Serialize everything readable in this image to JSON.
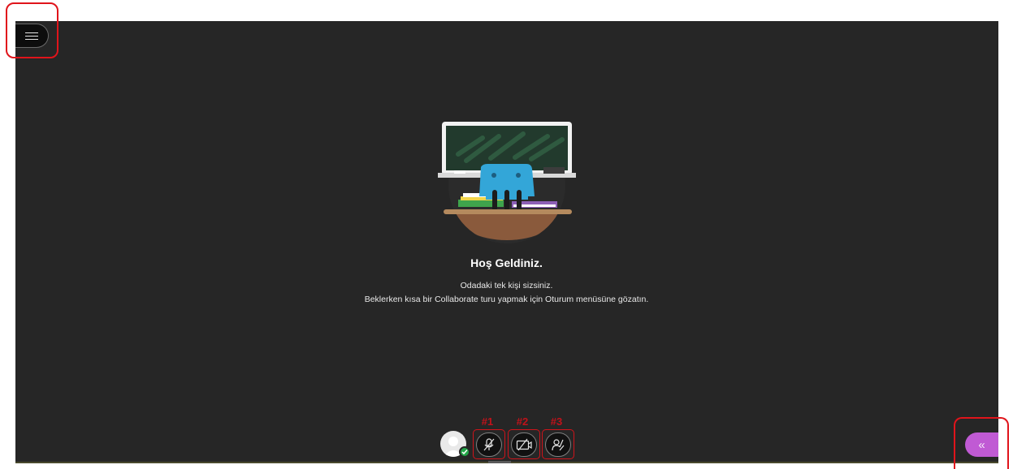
{
  "welcome": {
    "title": "Hoş Geldiniz.",
    "line1": "Odadaki tek kişi sizsiniz.",
    "line2": "Beklerken kısa bir Collaborate turu yapmak için Oturum menüsüne gözatın."
  },
  "controls": {
    "mic_label": "#1",
    "camera_label": "#2",
    "hand_label": "#3"
  },
  "collab_panel": {
    "toggle_glyph": "«"
  },
  "icons": {
    "menu": "hamburger-menu-icon",
    "mic": "microphone-muted-icon",
    "camera": "camera-off-icon",
    "hand": "raise-hand-icon",
    "avatar": "user-avatar-icon",
    "status": "status-check-icon",
    "collab": "chevron-double-left-icon"
  },
  "colors": {
    "stage": "#262626",
    "annotation": "#e0141b",
    "collab_accent": "#c05ad4",
    "status_green": "#23a548"
  }
}
